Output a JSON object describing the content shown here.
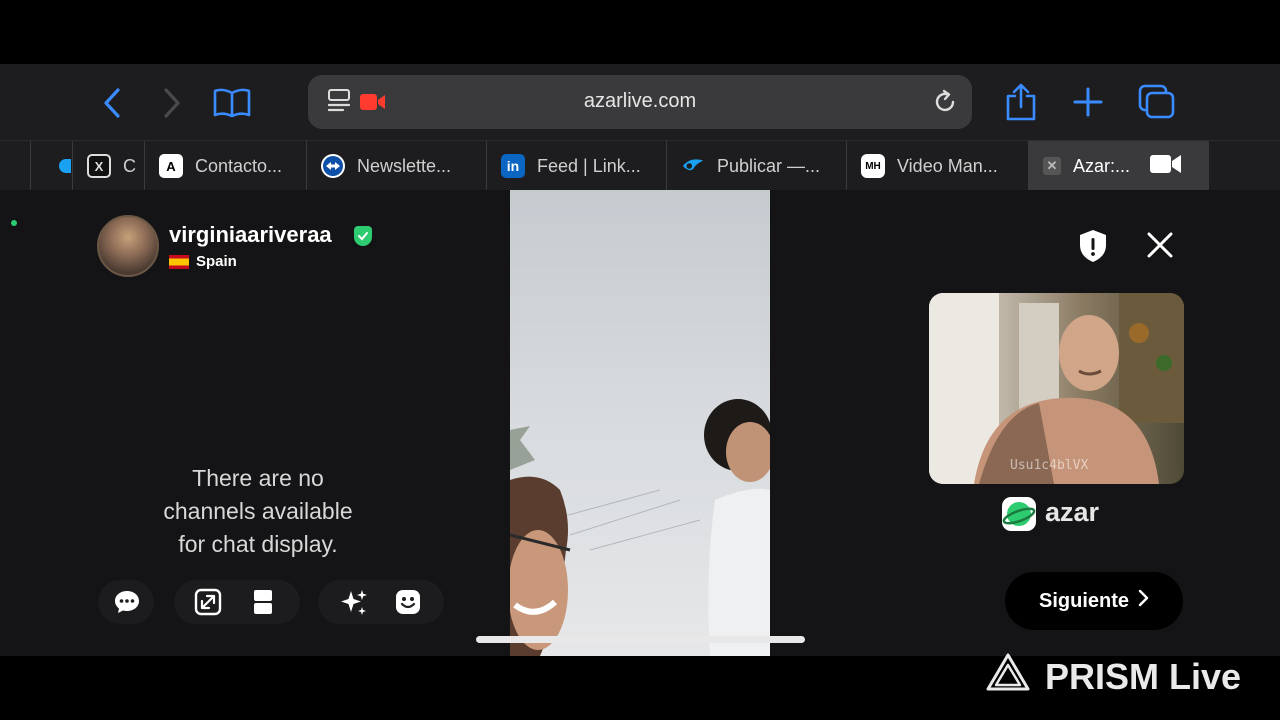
{
  "browser": {
    "url": "azarlive.com",
    "tabs": [
      {
        "label": "C",
        "icon": "x-icon"
      },
      {
        "label": "Contacto...",
        "icon": "a-logo-icon"
      },
      {
        "label": "Newslette...",
        "icon": "teamviewer-icon"
      },
      {
        "label": "Feed | Link...",
        "icon": "linkedin-icon"
      },
      {
        "label": "Publicar —...",
        "icon": "flying-icon"
      },
      {
        "label": "Video Man...",
        "icon": "mh-icon"
      },
      {
        "label": "Azar:...",
        "icon": "close-icon",
        "active": true
      }
    ]
  },
  "profile": {
    "username": "virginiaariveraa",
    "country": "Spain"
  },
  "chat": {
    "empty_message": "There are no channels available for chat display."
  },
  "pip": {
    "user_id": "Usu1c4blVX"
  },
  "brand": {
    "name": "azar"
  },
  "actions": {
    "next_label": "Siguiente"
  },
  "watermark": {
    "text": "PRISM Live"
  },
  "colors": {
    "accent": "#3a8bff",
    "record": "#ff3b30",
    "verified": "#2ecc71"
  }
}
